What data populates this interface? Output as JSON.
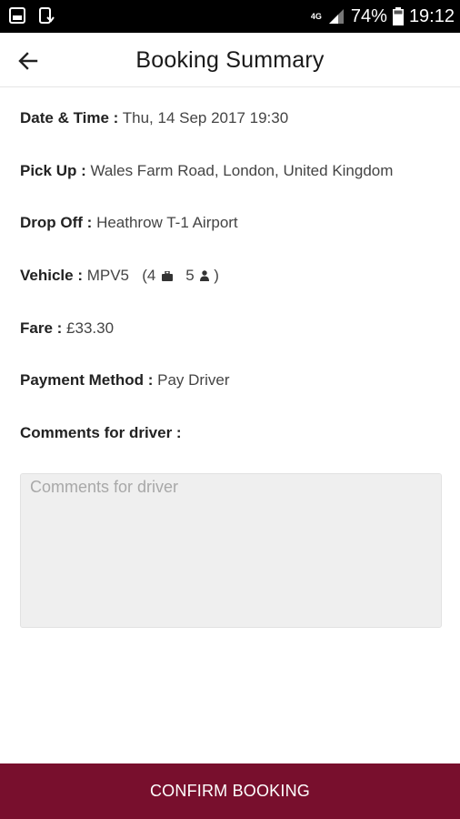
{
  "status_bar": {
    "network": "4G",
    "battery": "74%",
    "time": "19:12",
    "icons": [
      "gallery-icon",
      "phone-sync-icon",
      "signal-icon",
      "battery-icon"
    ]
  },
  "header": {
    "title": "Booking Summary",
    "back_icon": "arrow-left-icon"
  },
  "booking": {
    "date_time": {
      "label": "Date & Time :",
      "value": "Thu, 14 Sep 2017 19:30"
    },
    "pick_up": {
      "label": "Pick Up :",
      "value": "Wales Farm Road, London, United Kingdom"
    },
    "drop_off": {
      "label": "Drop Off :",
      "value": "Heathrow T-1 Airport"
    },
    "vehicle": {
      "label": "Vehicle :",
      "value": "MPV5",
      "luggage": "4",
      "passengers": "5",
      "luggage_icon": "suitcase-icon",
      "passengers_icon": "person-icon"
    },
    "fare": {
      "label": "Fare :",
      "value": "£33.30"
    },
    "payment_method": {
      "label": "Payment Method :",
      "value": "Pay Driver"
    },
    "comments": {
      "label": "Comments for driver :",
      "placeholder": "Comments for driver",
      "value": ""
    }
  },
  "actions": {
    "confirm_label": "CONFIRM BOOKING"
  },
  "colors": {
    "accent": "#780f2d",
    "text": "#222222",
    "input_bg": "#efefef"
  }
}
